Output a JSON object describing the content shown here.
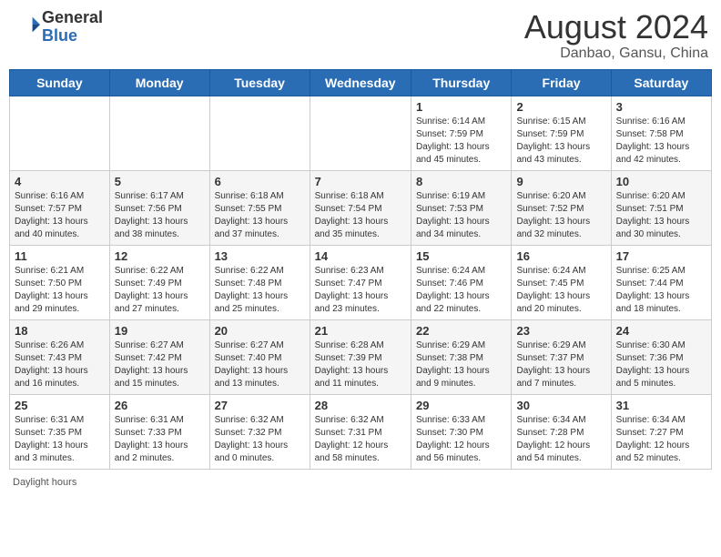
{
  "header": {
    "logo": {
      "general": "General",
      "blue": "Blue"
    },
    "title": "August 2024",
    "location": "Danbao, Gansu, China"
  },
  "calendar": {
    "days_of_week": [
      "Sunday",
      "Monday",
      "Tuesday",
      "Wednesday",
      "Thursday",
      "Friday",
      "Saturday"
    ],
    "weeks": [
      [
        {
          "day": "",
          "info": ""
        },
        {
          "day": "",
          "info": ""
        },
        {
          "day": "",
          "info": ""
        },
        {
          "day": "",
          "info": ""
        },
        {
          "day": "1",
          "info": "Sunrise: 6:14 AM\nSunset: 7:59 PM\nDaylight: 13 hours\nand 45 minutes."
        },
        {
          "day": "2",
          "info": "Sunrise: 6:15 AM\nSunset: 7:59 PM\nDaylight: 13 hours\nand 43 minutes."
        },
        {
          "day": "3",
          "info": "Sunrise: 6:16 AM\nSunset: 7:58 PM\nDaylight: 13 hours\nand 42 minutes."
        }
      ],
      [
        {
          "day": "4",
          "info": "Sunrise: 6:16 AM\nSunset: 7:57 PM\nDaylight: 13 hours\nand 40 minutes."
        },
        {
          "day": "5",
          "info": "Sunrise: 6:17 AM\nSunset: 7:56 PM\nDaylight: 13 hours\nand 38 minutes."
        },
        {
          "day": "6",
          "info": "Sunrise: 6:18 AM\nSunset: 7:55 PM\nDaylight: 13 hours\nand 37 minutes."
        },
        {
          "day": "7",
          "info": "Sunrise: 6:18 AM\nSunset: 7:54 PM\nDaylight: 13 hours\nand 35 minutes."
        },
        {
          "day": "8",
          "info": "Sunrise: 6:19 AM\nSunset: 7:53 PM\nDaylight: 13 hours\nand 34 minutes."
        },
        {
          "day": "9",
          "info": "Sunrise: 6:20 AM\nSunset: 7:52 PM\nDaylight: 13 hours\nand 32 minutes."
        },
        {
          "day": "10",
          "info": "Sunrise: 6:20 AM\nSunset: 7:51 PM\nDaylight: 13 hours\nand 30 minutes."
        }
      ],
      [
        {
          "day": "11",
          "info": "Sunrise: 6:21 AM\nSunset: 7:50 PM\nDaylight: 13 hours\nand 29 minutes."
        },
        {
          "day": "12",
          "info": "Sunrise: 6:22 AM\nSunset: 7:49 PM\nDaylight: 13 hours\nand 27 minutes."
        },
        {
          "day": "13",
          "info": "Sunrise: 6:22 AM\nSunset: 7:48 PM\nDaylight: 13 hours\nand 25 minutes."
        },
        {
          "day": "14",
          "info": "Sunrise: 6:23 AM\nSunset: 7:47 PM\nDaylight: 13 hours\nand 23 minutes."
        },
        {
          "day": "15",
          "info": "Sunrise: 6:24 AM\nSunset: 7:46 PM\nDaylight: 13 hours\nand 22 minutes."
        },
        {
          "day": "16",
          "info": "Sunrise: 6:24 AM\nSunset: 7:45 PM\nDaylight: 13 hours\nand 20 minutes."
        },
        {
          "day": "17",
          "info": "Sunrise: 6:25 AM\nSunset: 7:44 PM\nDaylight: 13 hours\nand 18 minutes."
        }
      ],
      [
        {
          "day": "18",
          "info": "Sunrise: 6:26 AM\nSunset: 7:43 PM\nDaylight: 13 hours\nand 16 minutes."
        },
        {
          "day": "19",
          "info": "Sunrise: 6:27 AM\nSunset: 7:42 PM\nDaylight: 13 hours\nand 15 minutes."
        },
        {
          "day": "20",
          "info": "Sunrise: 6:27 AM\nSunset: 7:40 PM\nDaylight: 13 hours\nand 13 minutes."
        },
        {
          "day": "21",
          "info": "Sunrise: 6:28 AM\nSunset: 7:39 PM\nDaylight: 13 hours\nand 11 minutes."
        },
        {
          "day": "22",
          "info": "Sunrise: 6:29 AM\nSunset: 7:38 PM\nDaylight: 13 hours\nand 9 minutes."
        },
        {
          "day": "23",
          "info": "Sunrise: 6:29 AM\nSunset: 7:37 PM\nDaylight: 13 hours\nand 7 minutes."
        },
        {
          "day": "24",
          "info": "Sunrise: 6:30 AM\nSunset: 7:36 PM\nDaylight: 13 hours\nand 5 minutes."
        }
      ],
      [
        {
          "day": "25",
          "info": "Sunrise: 6:31 AM\nSunset: 7:35 PM\nDaylight: 13 hours\nand 3 minutes."
        },
        {
          "day": "26",
          "info": "Sunrise: 6:31 AM\nSunset: 7:33 PM\nDaylight: 13 hours\nand 2 minutes."
        },
        {
          "day": "27",
          "info": "Sunrise: 6:32 AM\nSunset: 7:32 PM\nDaylight: 13 hours\nand 0 minutes."
        },
        {
          "day": "28",
          "info": "Sunrise: 6:32 AM\nSunset: 7:31 PM\nDaylight: 12 hours\nand 58 minutes."
        },
        {
          "day": "29",
          "info": "Sunrise: 6:33 AM\nSunset: 7:30 PM\nDaylight: 12 hours\nand 56 minutes."
        },
        {
          "day": "30",
          "info": "Sunrise: 6:34 AM\nSunset: 7:28 PM\nDaylight: 12 hours\nand 54 minutes."
        },
        {
          "day": "31",
          "info": "Sunrise: 6:34 AM\nSunset: 7:27 PM\nDaylight: 12 hours\nand 52 minutes."
        }
      ]
    ]
  },
  "footer": {
    "daylight_label": "Daylight hours"
  }
}
